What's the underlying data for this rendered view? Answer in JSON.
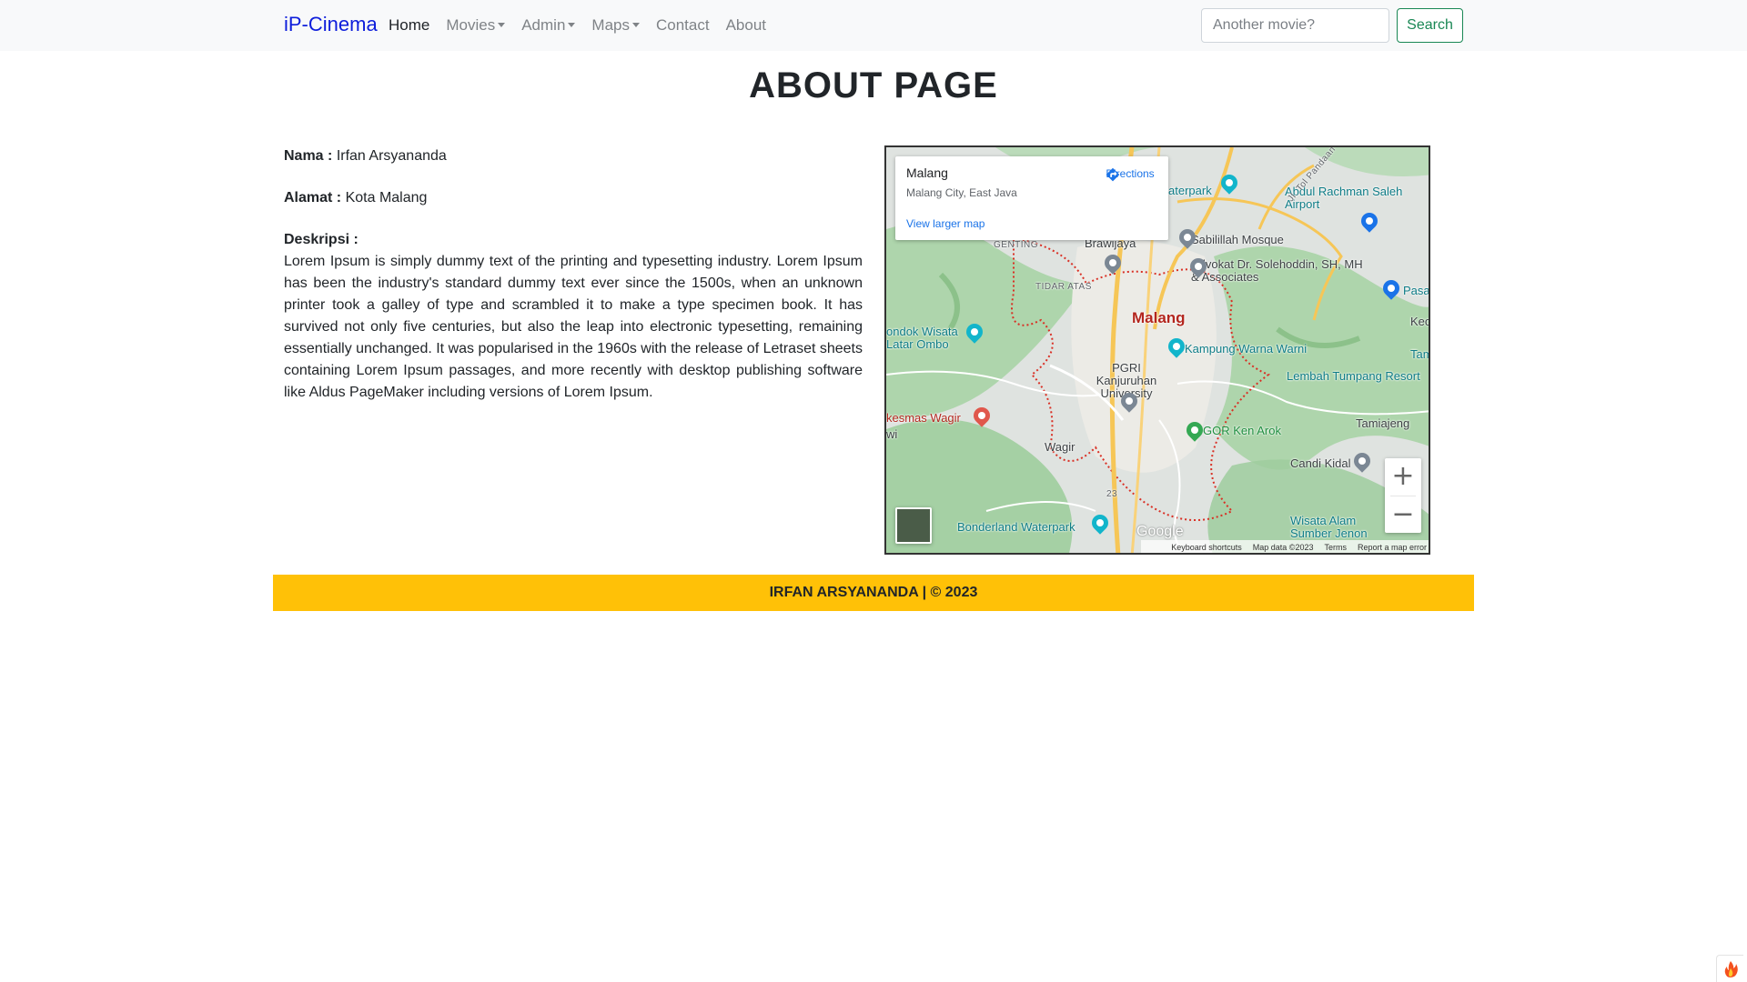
{
  "navbar": {
    "brand": "iP-Cinema",
    "links": [
      {
        "label": "Home",
        "dropdown": false,
        "active": true
      },
      {
        "label": "Movies",
        "dropdown": true,
        "active": false
      },
      {
        "label": "Admin",
        "dropdown": true,
        "active": false
      },
      {
        "label": "Maps",
        "dropdown": true,
        "active": false
      },
      {
        "label": "Contact",
        "dropdown": false,
        "active": false
      },
      {
        "label": "About",
        "dropdown": false,
        "active": false
      }
    ],
    "search_placeholder": "Another movie?",
    "search_button": "Search"
  },
  "page": {
    "title": "ABOUT PAGE"
  },
  "info": {
    "nama_label": "Nama :",
    "nama_value": "Irfan Arsyananda",
    "alamat_label": "Alamat :",
    "alamat_value": "Kota Malang",
    "deskripsi_label": "Deskripsi :",
    "deskripsi_text": "Lorem Ipsum is simply dummy text of the printing and typesetting industry. Lorem Ipsum has been the industry's standard dummy text ever since the 1500s, when an unknown printer took a galley of type and scrambled it to make a type specimen book. It has survived not only five centuries, but also the leap into electronic typesetting, remaining essentially unchanged. It was popularised in the 1960s with the release of Letraset sheets containing Lorem Ipsum passages, and more recently with desktop publishing software like Aldus PageMaker including versions of Lorem Ipsum."
  },
  "map": {
    "place_name": "Malang",
    "place_sub": "Malang City, East Java",
    "directions": "Directions",
    "larger_map": "View larger map",
    "zoom_in": "+",
    "zoom_out": "−",
    "google": "Google",
    "footer_links": [
      "Keyboard shortcuts",
      "Map data ©2023",
      "Terms",
      "Report a map error"
    ],
    "labels": {
      "city": "Malang",
      "airport": "Abdul Rachman Saleh Airport",
      "mosque": "Sabilillah Mosque",
      "advokat": "Advokat Dr. Solehoddin, SH, MH & Associates",
      "brawijaya": "Brawijaya",
      "kampung": "Kampung Warna Warni",
      "wisata": "ondok Wisata Latar Ombo",
      "pgri": "PGRI Kanjuruhan University",
      "lembah": "Lembah Tumpang Resort",
      "puskesmas": "kesmas Wagir",
      "gor": "GOR Ken Arok",
      "tamiajeng": "Tamiajeng",
      "wagir": "Wagir",
      "candi": "Candi Kidal",
      "bonderland": "Bonderland Waterpark",
      "sumber": "Wisata Alam Sumber Jenon",
      "waterpark": "aterpark",
      "tidar": "TIDAR ATAS",
      "genting": "GENTING",
      "pasa": "Pasa",
      "kec": "Kec",
      "tam": "Tam",
      "wi": "wi",
      "road23": "23",
      "jalan": "Jl. Tol Pandaan"
    }
  },
  "footer": {
    "text": "IRFAN ARSYANANDA | © 2023"
  },
  "colors": {
    "brand": "#0d1ddb",
    "search_button": "#198754",
    "footer_bg": "#ffc107",
    "navbar_bg": "#f8f9fa"
  }
}
